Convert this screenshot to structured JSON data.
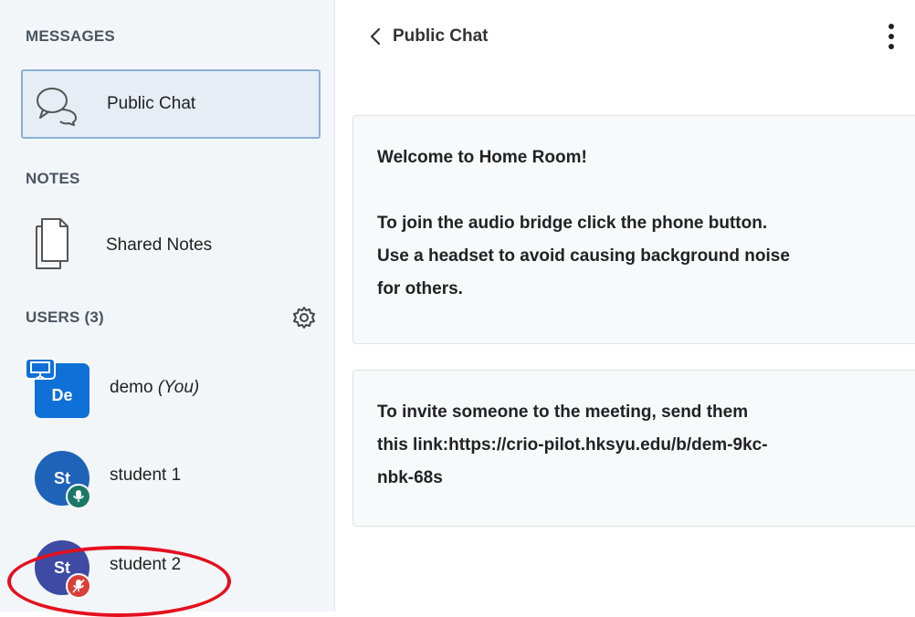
{
  "sidebar": {
    "messages_title": "MESSAGES",
    "public_chat_label": "Public Chat",
    "notes_title": "NOTES",
    "shared_notes_label": "Shared Notes",
    "users_title": "USERS (3)",
    "users": [
      {
        "initials": "De",
        "name": "demo",
        "suffix": "(You)"
      },
      {
        "initials": "St",
        "name": "student 1"
      },
      {
        "initials": "St",
        "name": "student 2"
      }
    ]
  },
  "chat": {
    "title": "Public Chat",
    "messages": [
      {
        "welcome_prefix": "Welcome to ",
        "welcome_room": "Home Room!",
        "line2": "To join the audio bridge click the phone button.",
        "line3": "Use a headset to avoid causing background noise",
        "line4": "for others."
      },
      {
        "line1": "To invite someone to the meeting, send them",
        "line2": "this link:https://crio-pilot.hksyu.edu/b/dem-9kc-",
        "line3": "nbk-68s"
      }
    ]
  },
  "colors": {
    "accent": "#0f70d7",
    "selected_border": "#8ab0d8",
    "annotation": "#e4101f",
    "mic_teal": "#1b7868",
    "mic_red": "#d93f39"
  },
  "icons": {
    "chat": "chat-bubbles-icon",
    "notes": "document-icon",
    "settings": "gear-icon",
    "back": "chevron-left-icon",
    "more": "kebab-menu-icon",
    "presenter": "presenter-screen-icon",
    "mic": "microphone-icon",
    "mic_muted": "microphone-muted-icon"
  }
}
